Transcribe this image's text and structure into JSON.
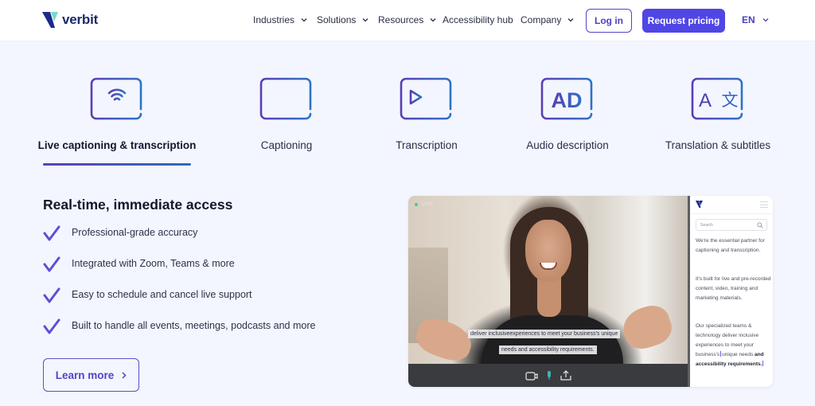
{
  "header": {
    "brand": "verbit",
    "nav": [
      {
        "label": "Industries",
        "dropdown": true
      },
      {
        "label": "Solutions",
        "dropdown": true
      },
      {
        "label": "Resources",
        "dropdown": true
      },
      {
        "label": "Accessibility hub",
        "dropdown": false
      },
      {
        "label": "Company",
        "dropdown": true
      }
    ],
    "login_label": "Log in",
    "pricing_label": "Request pricing",
    "language": "EN"
  },
  "tabs": [
    {
      "label": "Live captioning & transcription",
      "icon": "live-caption-icon",
      "active": true
    },
    {
      "label": "Captioning",
      "icon": "captioning-icon",
      "active": false
    },
    {
      "label": "Transcription",
      "icon": "transcription-icon",
      "active": false
    },
    {
      "label": "Audio description",
      "icon": "audio-description-icon",
      "active": false,
      "icon_text": "AD"
    },
    {
      "label": "Translation & subtitles",
      "icon": "translation-icon",
      "active": false,
      "icon_text_left": "A",
      "icon_text_right": "文"
    }
  ],
  "content": {
    "title": "Real-time, immediate access",
    "features": [
      "Professional-grade accuracy",
      "Integrated with Zoom, Teams & more",
      "Easy to schedule and cancel live support",
      "Built to handle all events, meetings, podcasts and more"
    ],
    "learn_more_label": "Learn more"
  },
  "media": {
    "live_label": "LIVE",
    "caption_line1": "deliver inclusiveexperiences to meet your business's unique",
    "caption_line2": "needs and accessibility requirements.",
    "controls": [
      "camera-icon",
      "microphone-icon",
      "share-icon"
    ],
    "sidebar": {
      "search_placeholder": "Search",
      "para1": "We're the essential partner for captioning and transcription.",
      "para2": "It's built for live and pre-recorded content, video, training and marketing materials.",
      "para3_a": "Our specialized teams & technology deliver inclusive experiences to meet your business's",
      "para3_b": "unique needs",
      "para3_bold": "and accessibility requirements."
    }
  },
  "colors": {
    "accent": "#4f46e5",
    "background": "#f3f6fe",
    "check": "#5b4fd9",
    "live_dot": "#35d49a"
  }
}
